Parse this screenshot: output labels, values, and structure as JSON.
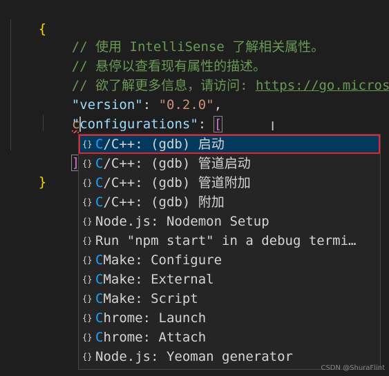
{
  "code": {
    "open_brace": "{",
    "comment1": "// 使用 IntelliSense 了解相关属性。",
    "comment2": "// 悬停以查看现有属性的描述。",
    "comment3_prefix": "// 欲了解更多信息，请访问: ",
    "comment3_link": "https://go.microsof",
    "version_key": "\"version\"",
    "version_colon": ": ",
    "version_value": "\"0.2.0\"",
    "version_comma": ",",
    "config_key": "\"configurations\"",
    "config_colon": ": ",
    "config_open": "[",
    "typed_text": "c",
    "config_close": "]",
    "close_brace": "}"
  },
  "suggest": {
    "selected_index": 0,
    "icon": "{}",
    "items": [
      {
        "match": "C",
        "rest": "/C++: (gdb) 启动"
      },
      {
        "match": "C",
        "rest": "/C++: (gdb) 管道启动"
      },
      {
        "match": "C",
        "rest": "/C++: (gdb) 管道附加"
      },
      {
        "match": "C",
        "rest": "/C++: (gdb) 附加"
      },
      {
        "match": "",
        "rest": "Node.js: Nodemon Setup"
      },
      {
        "match": "",
        "rest": "Run \"npm start\" in a debug termi…"
      },
      {
        "match": "C",
        "rest": "Make: Configure"
      },
      {
        "match": "C",
        "rest": "Make: External"
      },
      {
        "match": "C",
        "rest": "Make: Script"
      },
      {
        "match": "C",
        "rest": "hrome: Launch"
      },
      {
        "match": "C",
        "rest": "hrome: Attach"
      },
      {
        "match": "",
        "rest": "Node.js: Yeoman generator"
      }
    ]
  },
  "watermark": "CSDN @ShuraFlint",
  "colors": {
    "background": "#1e1e1e",
    "comment": "#6a9955",
    "key": "#9cdcfe",
    "string": "#ce9178",
    "brace": "#ffd700",
    "bracket": "#da70d6",
    "match_highlight": "#18a3ff",
    "selection_border": "#e0262f"
  }
}
